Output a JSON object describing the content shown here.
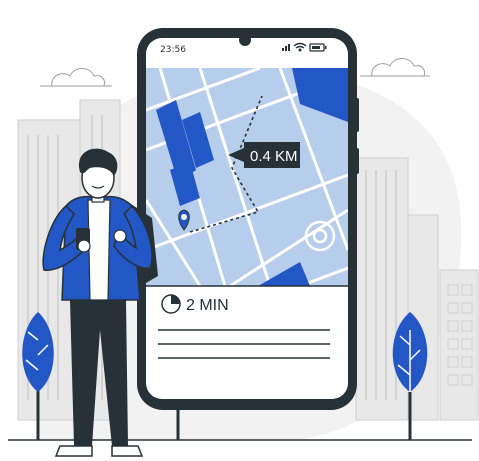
{
  "phone": {
    "status_time": "23:56",
    "status_icons": [
      "signal-icon",
      "wifi-icon",
      "battery-icon"
    ]
  },
  "map": {
    "distance_label": "0.4 KM",
    "destination_icon": "location-pin-icon"
  },
  "route_card": {
    "eta_icon": "timer-icon",
    "eta_label": "2 MIN"
  },
  "colors": {
    "accent": "#2457C6",
    "map_background": "#B7CDEC",
    "dark": "#263238",
    "city": "#E6E6E6"
  }
}
